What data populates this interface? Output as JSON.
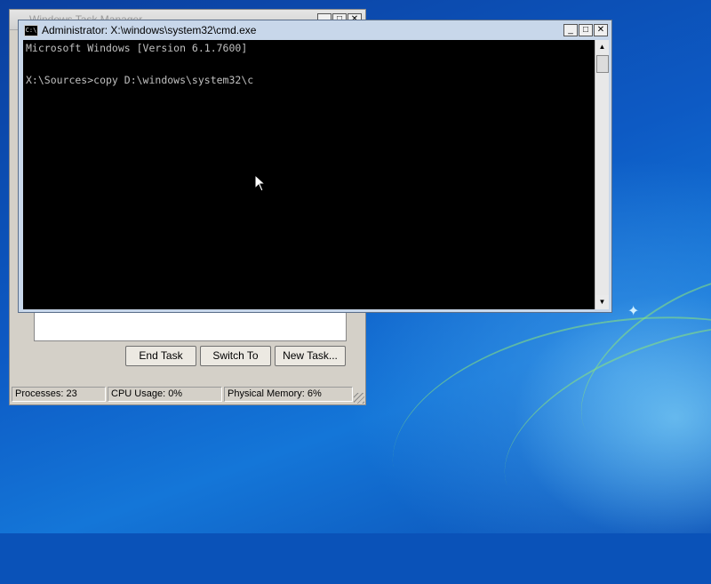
{
  "cmd_window": {
    "title": "Administrator: X:\\windows\\system32\\cmd.exe",
    "icon_label": "C:\\",
    "controls": {
      "minimize": "_",
      "maximize": "□",
      "close": "✕"
    },
    "console_lines": [
      "Microsoft Windows [Version 6.1.7600]",
      "",
      "X:\\Sources>copy D:\\windows\\system32\\c"
    ]
  },
  "task_manager": {
    "title": "Windows Task Manager",
    "controls": {
      "minimize": "_",
      "maximize": "□",
      "close": "✕"
    },
    "buttons": {
      "end_task": "End Task",
      "switch_to": "Switch To",
      "new_task": "New Task..."
    },
    "status": {
      "processes": "Processes: 23",
      "cpu": "CPU Usage: 0%",
      "memory": "Physical Memory: 6%"
    }
  },
  "icons": {
    "scroll_up": "▲",
    "scroll_down": "▼",
    "bird": "✦"
  }
}
